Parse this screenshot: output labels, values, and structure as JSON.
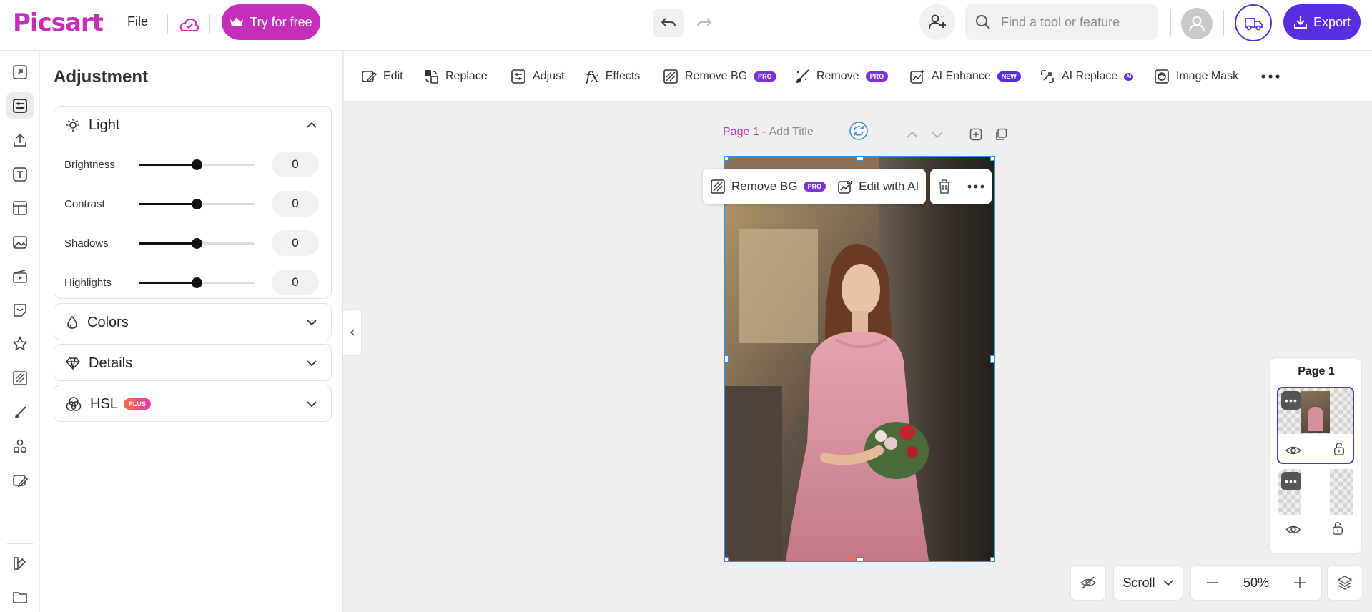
{
  "app": {
    "logo": "Picsart",
    "file_menu": "File",
    "try_label": "Try for free",
    "export_label": "Export"
  },
  "search": {
    "placeholder": "Find a tool or feature"
  },
  "toolbar": [
    {
      "label": "Edit",
      "badge": ""
    },
    {
      "label": "Replace",
      "badge": ""
    },
    {
      "label": "Adjust",
      "badge": ""
    },
    {
      "label": "Effects",
      "badge": ""
    },
    {
      "label": "Remove BG",
      "badge": "PRO"
    },
    {
      "label": "Remove",
      "badge": "PRO"
    },
    {
      "label": "AI Enhance",
      "badge": "NEW"
    },
    {
      "label": "AI Replace",
      "badge": "AI"
    },
    {
      "label": "Image Mask",
      "badge": ""
    }
  ],
  "panel": {
    "title": "Adjustment",
    "light": {
      "label": "Light",
      "sliders": [
        {
          "label": "Brightness",
          "value": "0",
          "level": 0.5
        },
        {
          "label": "Contrast",
          "value": "0",
          "level": 0.5
        },
        {
          "label": "Shadows",
          "value": "0",
          "level": 0.5
        },
        {
          "label": "Highlights",
          "value": "0",
          "level": 0.5
        }
      ]
    },
    "colors_label": "Colors",
    "details_label": "Details",
    "hsl_label": "HSL",
    "hsl_badge": "PLUS"
  },
  "canvas": {
    "page_prefix": "Page 1 -",
    "title_placeholder": "Add Title",
    "context": {
      "remove_bg": "Remove BG",
      "remove_bg_badge": "PRO",
      "edit_ai": "Edit with AI"
    }
  },
  "pages": {
    "title": "Page 1"
  },
  "bottom": {
    "scroll_label": "Scroll",
    "zoom": "50%"
  },
  "colors": {
    "brand": "#c42fba",
    "accent": "#5a2ee0",
    "selection": "#3d8bd9"
  }
}
